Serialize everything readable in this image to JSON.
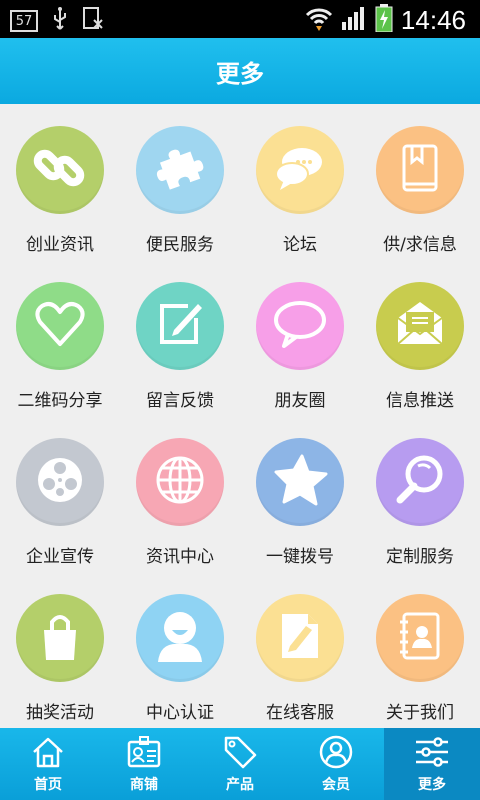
{
  "status_bar": {
    "badge": "57",
    "time": "14:46"
  },
  "header": {
    "title": "更多"
  },
  "grid": [
    {
      "label": "创业资讯",
      "icon": "link-icon",
      "color": "#b4cf6a"
    },
    {
      "label": "便民服务",
      "icon": "puzzle-icon",
      "color": "#9fd6f0"
    },
    {
      "label": "论坛",
      "icon": "chat-bubbles-icon",
      "color": "#fbe093"
    },
    {
      "label": "供/求信息",
      "icon": "book-icon",
      "color": "#fbc183"
    },
    {
      "label": "二维码分享",
      "icon": "heart-icon",
      "color": "#8fdc88"
    },
    {
      "label": "留言反馈",
      "icon": "edit-icon",
      "color": "#6fd4c5"
    },
    {
      "label": "朋友圈",
      "icon": "speech-bubble-icon",
      "color": "#f79fe8"
    },
    {
      "label": "信息推送",
      "icon": "envelope-icon",
      "color": "#c8cc4e"
    },
    {
      "label": "企业宣传",
      "icon": "film-reel-icon",
      "color": "#c3c8d0"
    },
    {
      "label": "资讯中心",
      "icon": "globe-icon",
      "color": "#f7a7b4"
    },
    {
      "label": "一键拨号",
      "icon": "star-icon",
      "color": "#8db5e6"
    },
    {
      "label": "定制服务",
      "icon": "magnifier-icon",
      "color": "#b79cf0"
    },
    {
      "label": "抽奖活动",
      "icon": "shopping-bag-icon",
      "color": "#b4cf6a"
    },
    {
      "label": "中心认证",
      "icon": "user-icon",
      "color": "#8fd3f3"
    },
    {
      "label": "在线客服",
      "icon": "document-edit-icon",
      "color": "#fbe093"
    },
    {
      "label": "关于我们",
      "icon": "contact-book-icon",
      "color": "#fbc183"
    }
  ],
  "tabs": [
    {
      "label": "首页",
      "icon": "home-icon"
    },
    {
      "label": "商铺",
      "icon": "id-card-icon"
    },
    {
      "label": "产品",
      "icon": "sale-tag-icon"
    },
    {
      "label": "会员",
      "icon": "member-icon"
    },
    {
      "label": "更多",
      "icon": "sliders-icon",
      "active": true
    }
  ]
}
